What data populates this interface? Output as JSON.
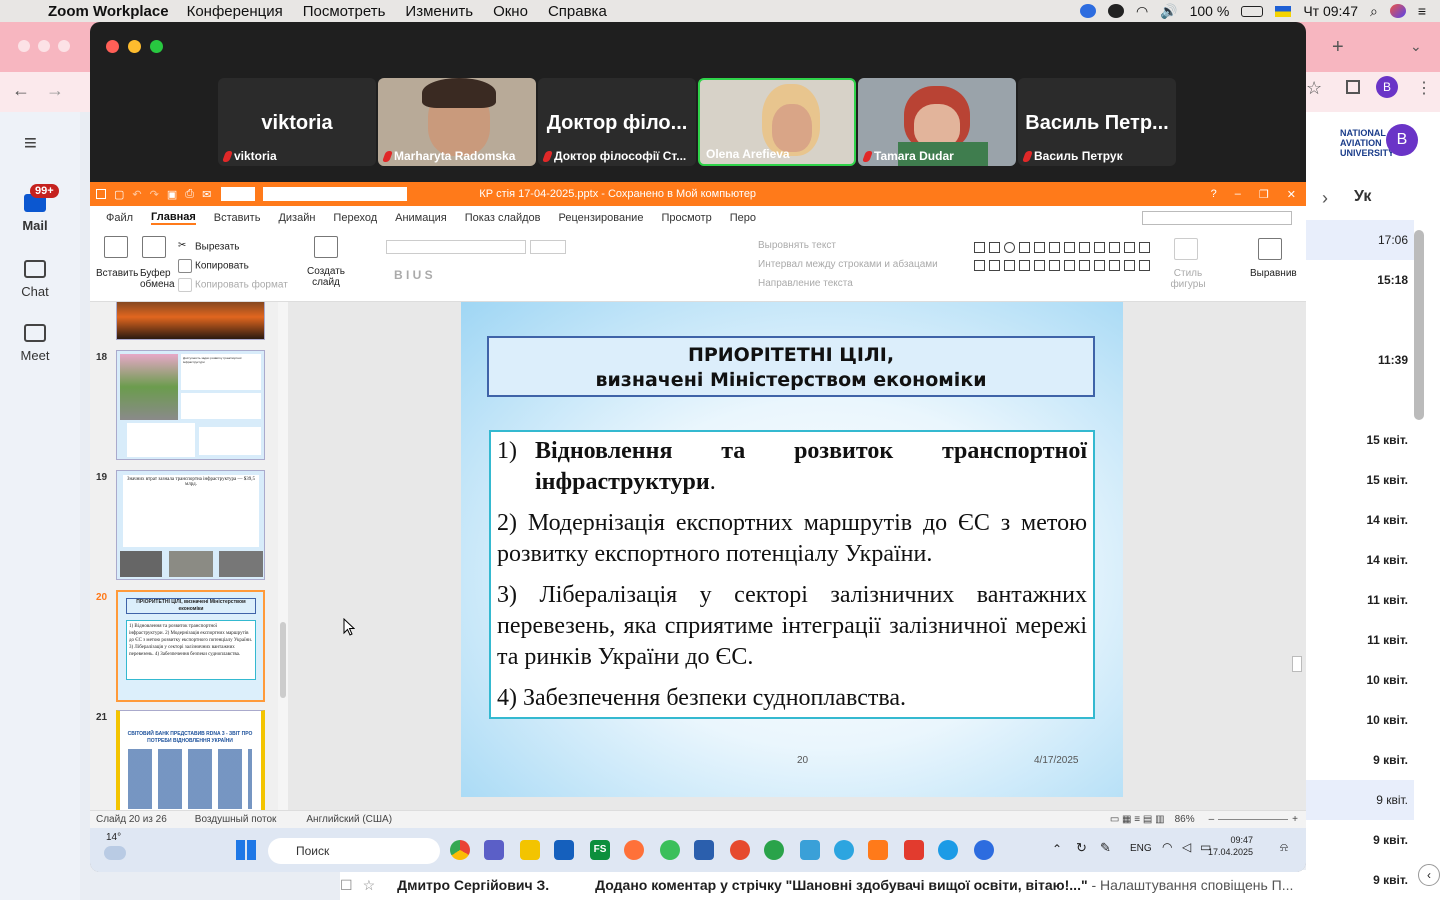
{
  "menubar": {
    "app": "Zoom Workplace",
    "items": [
      "Конференция",
      "Посмотреть",
      "Изменить",
      "Окно",
      "Справка"
    ],
    "battery": "100 %",
    "clock": "Чт 09:47"
  },
  "gmail": {
    "mail_label": "Mail",
    "mail_badge": "99+",
    "chat_label": "Chat",
    "meet_label": "Meet",
    "avatar": "B",
    "logo_text": "NATIONAL AVIATION UNIVERSITY",
    "sort_label": "Ук",
    "times": [
      "17:06",
      "15:18",
      "11:39",
      "15 квіт.",
      "15 квіт.",
      "14 квіт.",
      "14 квіт.",
      "11 квіт.",
      "11 квіт.",
      "10 квіт.",
      "10 квіт.",
      "9 квіт.",
      "9 квіт.",
      "9 квіт.",
      "9 квіт."
    ],
    "bottom_sender": "Дмитро Сергійович З.",
    "bottom_subject": "Додано коментар у стрічку \"Шановні здобувачі вищої освіти, вітаю!...\"",
    "bottom_snippet": " - Налаштування сповіщень П..."
  },
  "zoom": {
    "participants": [
      {
        "big": "viktoria",
        "label": "viktoria",
        "video": false
      },
      {
        "big": "",
        "label": "Marharyta Radomska",
        "video": true
      },
      {
        "big": "Доктор філо...",
        "label": "Доктор філософії Ст...",
        "video": false
      },
      {
        "big": "",
        "label": "Olena Arefieva",
        "video": true,
        "active": true
      },
      {
        "big": "",
        "label": "Tamara Dudar",
        "video": true
      },
      {
        "big": "Василь Петр...",
        "label": "Василь Петрук",
        "video": false
      }
    ]
  },
  "ppt": {
    "title": "КР стія 17-04-2025.pptx - Сохранено в Мой компьютер",
    "tabs": [
      "Файл",
      "Главная",
      "Вставить",
      "Дизайн",
      "Переход",
      "Анимация",
      "Показ слайдов",
      "Рецензирование",
      "Просмотр",
      "Перо"
    ],
    "ribbon": {
      "paste": "Вставить",
      "buffer": "Буфер обмена",
      "cut": "Вырезать",
      "copy": "Копировать",
      "format_copy": "Копировать формат",
      "create_slide": "Создать слайд",
      "text_direction": "Выровнять текст",
      "line_spacing": "Интервал между строками и абзацами",
      "direction": "Направление текста",
      "figure_style": "Стиль фигуры",
      "align": "Выравнив"
    },
    "thumbs": [
      {
        "num": "18",
        "title": "",
        "text": "Доступность задач розвитку транспортної інфраструктури"
      },
      {
        "num": "19",
        "title": "",
        "text": "Значних втрат зазнала транспортна інфраструктура — $39,5 млрд."
      },
      {
        "num": "20",
        "title": "ПРІОРИТЕТНІ ЦІЛІ, визначені Міністерством економіки",
        "text": "1) Відновлення та розвиток транспортної інфраструктури. 2) Модернізація експортних маршрутів до ЄС з метою розвитку експортного потенціалу України. 3) Лібералізація у секторі залізничних вантажних перевезень. 4) Забезпечення безпеки судноплавства."
      },
      {
        "num": "21",
        "title": "СВІТОВИЙ БАНК ПРЕДСТАВИВ RDNA 3 - ЗВІТ ПРО ПОТРЕБИ ВІДНОВЛЕННЯ УКРАЇНИ",
        "text": ""
      }
    ],
    "slide": {
      "heading_line1": "ПРИОРІТЕТНІ ЦІЛІ,",
      "heading_line2": "визначені Міністерством економіки",
      "item1_num": "1)",
      "item1_bold": "Відновлення та розвиток транспортної інфраструктури",
      "item1_end": ".",
      "item2": "2) Модернізація експортних маршрутів до ЄС з метою розвитку експортного потенціалу України.",
      "item3": "3) Лібералізація у секторі залізничних вантажних перевезень, яка сприятиме інтеграції залізничної мережі та ринків України до ЄС.",
      "item4": "4) Забезпечення безпеки судноплавства.",
      "number": "20",
      "date": "4/17/2025"
    },
    "status": {
      "slide_info": "Слайд 20 из 26",
      "theme": "Воздушный поток",
      "language": "Английский (США)",
      "zoom": "86%"
    }
  },
  "taskbar": {
    "weather": "14°",
    "search": "Поиск",
    "lang": "ENG",
    "time": "09:47",
    "date": "17.04.2025"
  },
  "colors": {
    "ppt_orange": "#ff7a1a",
    "zoom_bg": "#1f1f1f",
    "active_speaker": "#2fd34a",
    "slide_heading_border": "#3f63a8",
    "slide_body_border": "#34b9d0"
  }
}
